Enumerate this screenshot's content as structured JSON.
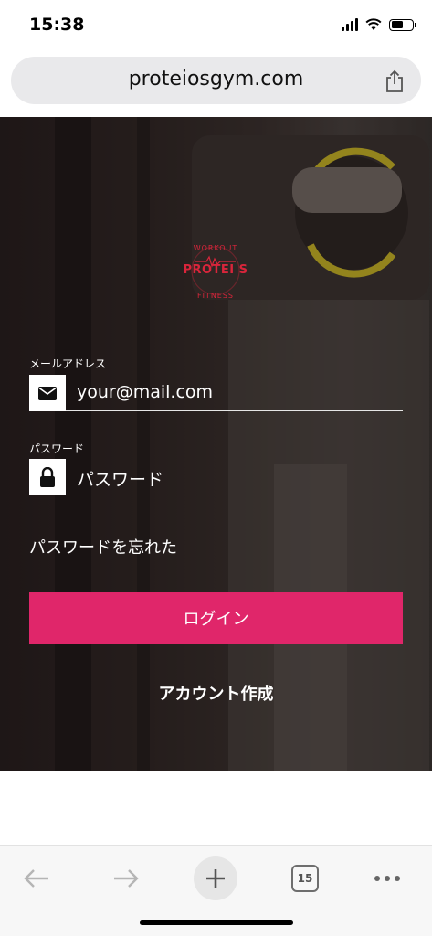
{
  "status_bar": {
    "time": "15:38"
  },
  "browser": {
    "url": "proteiosgym.com",
    "tab_count": "15"
  },
  "logo": {
    "brand": "PROTEI S",
    "top_text": "WORKOUT",
    "bottom_text": "FITNESS",
    "color": "#d9253b"
  },
  "form": {
    "email_label": "メールアドレス",
    "email_placeholder": "your@mail.com",
    "password_label": "パスワード",
    "password_placeholder": "パスワード",
    "forgot_password": "パスワードを忘れた",
    "login_button": "ログイン",
    "create_account": "アカウント作成"
  },
  "colors": {
    "accent": "#e0266a",
    "background_dark": "#2f2624"
  }
}
